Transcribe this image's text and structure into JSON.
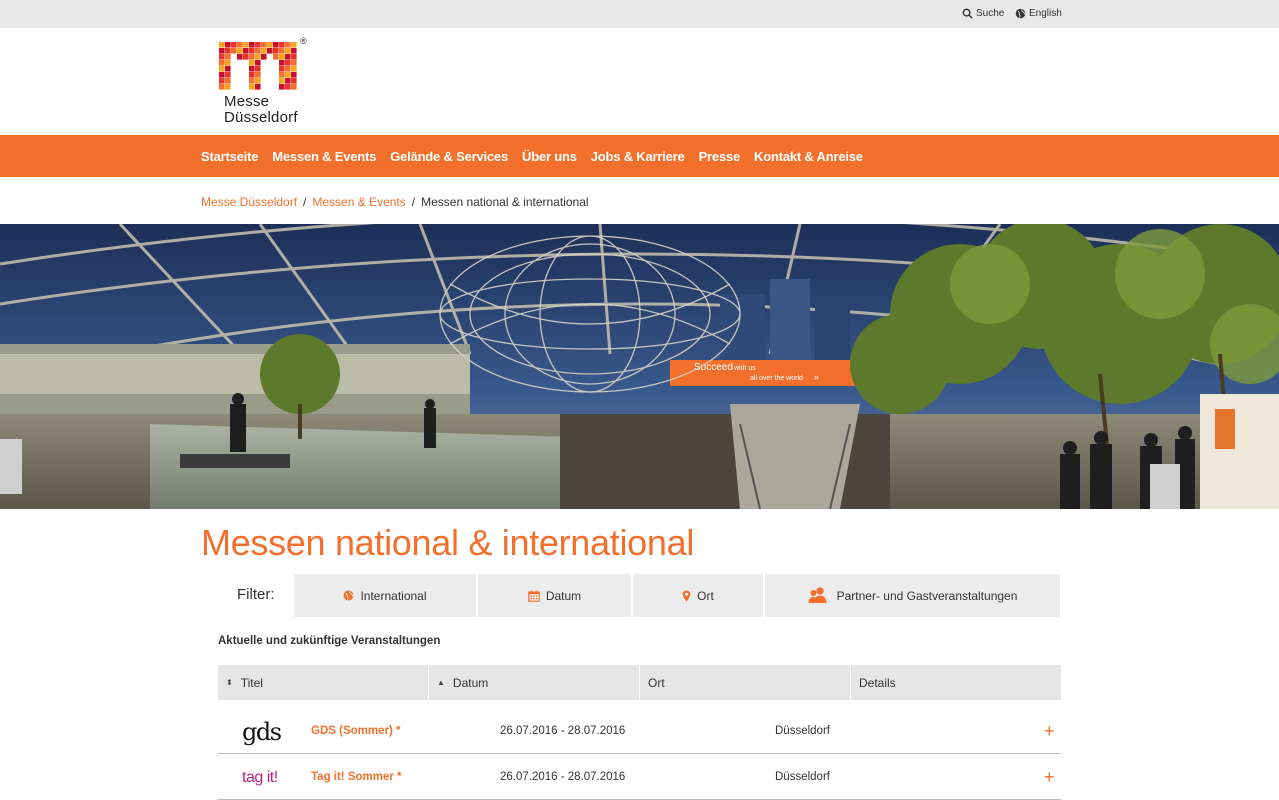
{
  "topbar": {
    "search_label": "Suche",
    "language_label": "English"
  },
  "logo": {
    "line1": "Messe",
    "line2": "Düsseldorf",
    "registered": "®",
    "colors": [
      "#f7a51c",
      "#f26f2c",
      "#e8332a",
      "#c8102e"
    ]
  },
  "nav": {
    "items": [
      {
        "label": "Startseite"
      },
      {
        "label": "Messen & Events"
      },
      {
        "label": "Gelände & Services"
      },
      {
        "label": "Über uns"
      },
      {
        "label": "Jobs & Karriere"
      },
      {
        "label": "Presse"
      },
      {
        "label": "Kontakt & Anreise"
      }
    ]
  },
  "breadcrumb": {
    "items": [
      {
        "label": "Messe Düsseldorf"
      },
      {
        "label": "Messen & Events"
      }
    ],
    "separator": "/",
    "current": "Messen national & international"
  },
  "hero": {
    "banner_text_1": "Succeed",
    "banner_text_2": "with us",
    "banner_text_3": "all over the world",
    "banner_arrows": "»"
  },
  "page": {
    "title": "Messen national & international"
  },
  "filter": {
    "label": "Filter:",
    "buttons": [
      {
        "label": "International",
        "icon": "globe-icon"
      },
      {
        "label": "Datum",
        "icon": "calendar-icon"
      },
      {
        "label": "Ort",
        "icon": "map-pin-icon"
      },
      {
        "label": "Partner- und Gastveranstaltungen",
        "icon": "people-icon"
      }
    ]
  },
  "events": {
    "section_title": "Aktuelle und zukünftige Veranstaltungen",
    "columns": [
      {
        "label": "Titel",
        "sort": "⬍"
      },
      {
        "label": "Datum",
        "sort": "▲"
      },
      {
        "label": "Ort",
        "sort": ""
      },
      {
        "label": "Details",
        "sort": ""
      }
    ],
    "rows": [
      {
        "brand": "gds",
        "title": "GDS (Sommer) *",
        "date": "26.07.2016 - 28.07.2016",
        "place": "Düsseldorf",
        "expand": "+"
      },
      {
        "brand": "tag it!",
        "title": "Tag it! Sommer *",
        "date": "26.07.2016 - 28.07.2016",
        "place": "Düsseldorf",
        "expand": "+"
      }
    ]
  },
  "colors": {
    "accent": "#f26f2c",
    "topbar_bg": "#e9e9e9",
    "filter_bg": "#ececec",
    "table_header_bg": "#e6e6e6"
  }
}
